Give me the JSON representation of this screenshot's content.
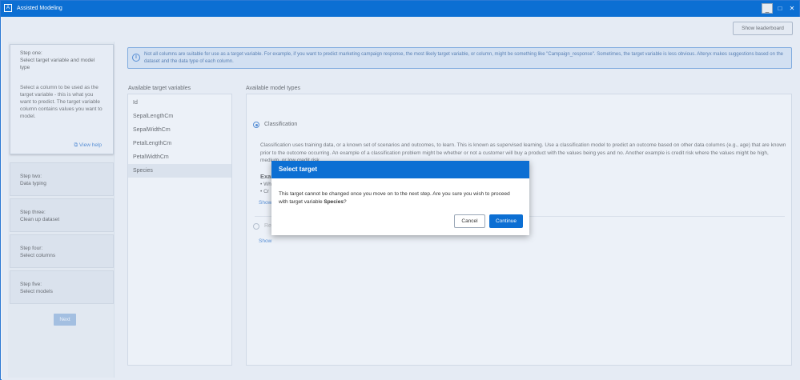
{
  "window": {
    "title": "Assisted Modeling",
    "app_icon": "alteryx-icon",
    "min_glyph": "_",
    "max_glyph": "□",
    "close_glyph": "✕"
  },
  "toolbar": {
    "leaderboard_label": "Show leaderboard"
  },
  "steps": [
    {
      "label": "Step one:",
      "title": "Select target variable and model type",
      "description": "Select a column to be used as the target variable - this is what you want to predict. The target variable column contains values you want to model.",
      "help_label": "View help"
    },
    {
      "label": "Step two:",
      "title": "Data typing"
    },
    {
      "label": "Step three:",
      "title": "Clean up dataset"
    },
    {
      "label": "Step four:",
      "title": "Select columns"
    },
    {
      "label": "Step five:",
      "title": "Select models"
    }
  ],
  "next_label": "Next",
  "info_text": "Not all columns are suitable for use as a target variable. For example, if you want to predict marketing campaign response, the most likely target variable, or column, might be something like \"Campaign_response\". Sometimes, the target variable is less obvious. Alteryx makes suggestions based on the dataset and the data type of each column.",
  "variables": {
    "title": "Available target variables",
    "items": [
      "Id",
      "SepalLengthCm",
      "SepalWidthCm",
      "PetalLengthCm",
      "PetalWidthCm",
      "Species"
    ],
    "selected": "Species"
  },
  "models": {
    "title": "Available model types",
    "classification_label": "Classification",
    "classification_desc": "Classification uses training data, or a known set of scenarios and outcomes, to learn. This is known as supervised learning. Use a classification model to predict an outcome based on other data columns (e.g., age) that are known prior to the outcome occurring. An example of a classification problem might be whether or not a customer will buy a product with the values being yes and no. Another example is credit risk where the values might be high, medium, or low credit risk.",
    "examples_title": "Examples:",
    "bullet_1": "• Wh",
    "bullet_2": "• Cr",
    "show_1": "Show",
    "regression_label": "Re",
    "show_2": "Show"
  },
  "modal": {
    "title": "Select target",
    "body_prefix": "This target cannot be changed once you move on to the next step. Are you sure you wish to proceed with target variable ",
    "body_target": "Species",
    "body_suffix": "?",
    "cancel_label": "Cancel",
    "continue_label": "Continue"
  }
}
